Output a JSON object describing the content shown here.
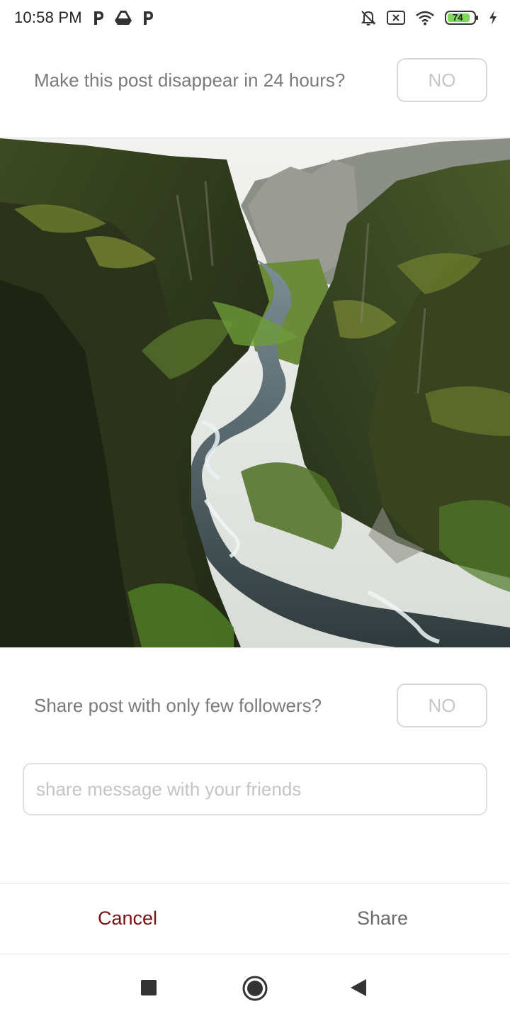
{
  "status_bar": {
    "time": "10:58 PM",
    "battery": "74",
    "icons_left": [
      "p-icon",
      "drive-icon",
      "p-icon"
    ],
    "icons_right": [
      "bell-off-icon",
      "no-sim-icon",
      "wifi-icon",
      "battery-icon",
      "charging-icon"
    ]
  },
  "disappear": {
    "label": "Make this post disappear in 24 hours?",
    "toggle": "NO"
  },
  "followers": {
    "label": "Share post with only few followers?",
    "toggle": "NO"
  },
  "message": {
    "placeholder": "share message with your friends",
    "value": ""
  },
  "actions": {
    "cancel": "Cancel",
    "share": "Share"
  },
  "colors": {
    "cancel": "#7a1010",
    "share": "#6a6a6a",
    "label": "#7a7a7a",
    "battery_fill": "#7ed957"
  },
  "nav": [
    "recents-square-icon",
    "home-circle-icon",
    "back-triangle-icon"
  ]
}
